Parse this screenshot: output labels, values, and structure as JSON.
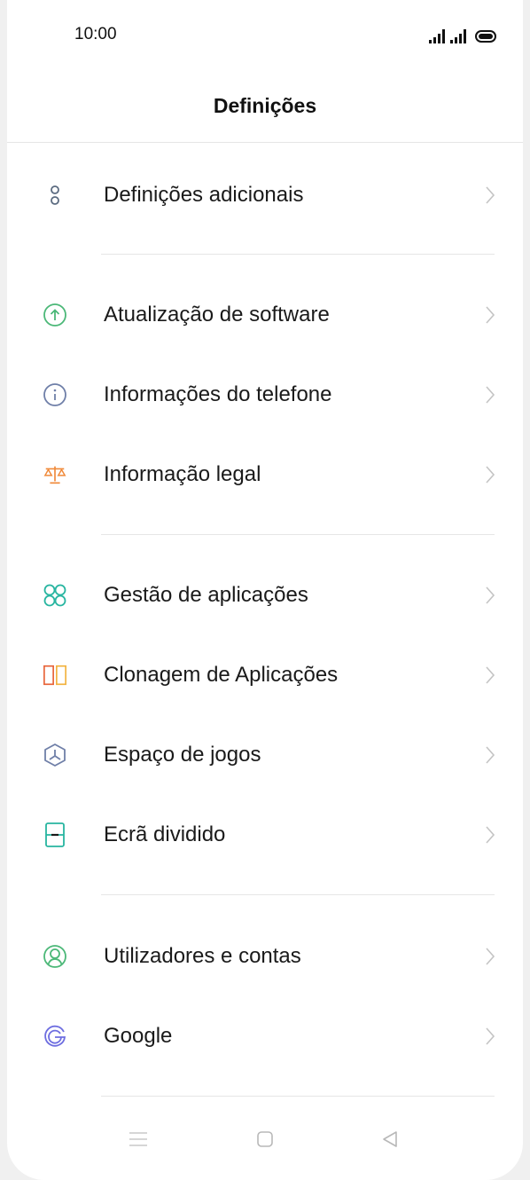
{
  "status_bar": {
    "time": "10:00"
  },
  "header": {
    "title": "Definições"
  },
  "settings": {
    "additional": "Definições adicionais",
    "software_update": "Atualização de software",
    "phone_info": "Informações do telefone",
    "legal_info": "Informação legal",
    "app_management": "Gestão de aplicações",
    "app_cloning": "Clonagem de Aplicações",
    "game_space": "Espaço de jogos",
    "split_screen": "Ecrã dividido",
    "users_accounts": "Utilizadores e contas",
    "google": "Google"
  },
  "icons": {
    "additional": "dots-vertical-icon",
    "software_update": "arrow-up-circle-icon",
    "phone_info": "info-circle-icon",
    "legal_info": "scales-icon",
    "app_management": "app-grid-icon",
    "app_cloning": "clone-icon",
    "game_space": "game-space-icon",
    "split_screen": "split-screen-icon",
    "users_accounts": "user-circle-icon",
    "google": "google-icon"
  },
  "colors": {
    "gray_icon": "#5b6b80",
    "green": "#4cb878",
    "blue_gray": "#6f7fa8",
    "orange": "#f08a3a",
    "teal": "#27b5a0",
    "purple": "#6d6de0"
  }
}
